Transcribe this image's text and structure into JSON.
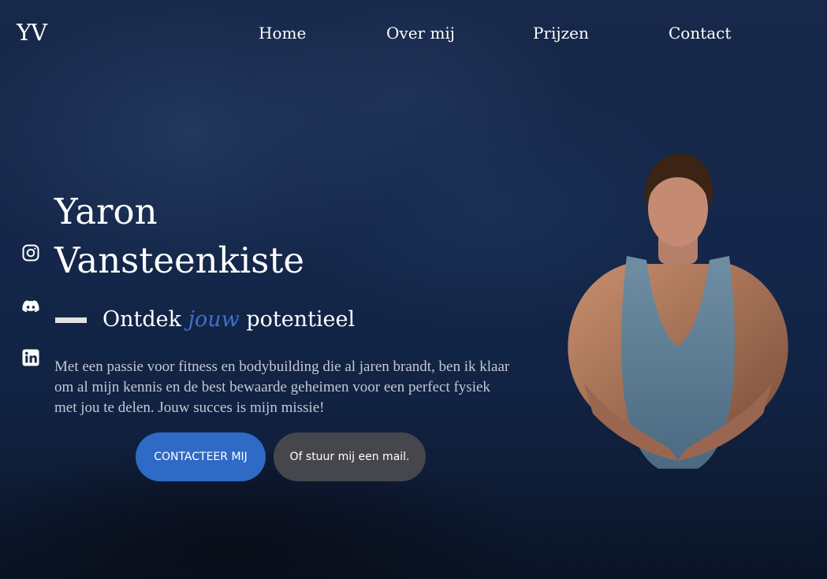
{
  "logo": "YV",
  "nav": {
    "items": [
      "Home",
      "Over mij",
      "Prijzen",
      "Contact"
    ]
  },
  "social": {
    "icons": [
      "instagram-icon",
      "discord-icon",
      "linkedin-icon"
    ]
  },
  "hero": {
    "name": "Yaron Vansteenkiste",
    "tagline_pre": "Ontdek ",
    "tagline_accent": "jouw",
    "tagline_post": " potentieel",
    "intro": "Met een passie voor fitness en bodybuilding die al jaren brandt, ben ik klaar om al mijn kennis en de best bewaarde geheimen voor een perfect fysiek met jou te delen. Jouw succes is mijn missie!"
  },
  "buttons": {
    "primary": "CONTACTEER MIJ",
    "secondary": "Of stuur mij een mail."
  },
  "colors": {
    "accent": "#3d6fd0",
    "primary_button": "#2f6ac6",
    "secondary_button": "#45474c",
    "background": "#14274a"
  }
}
